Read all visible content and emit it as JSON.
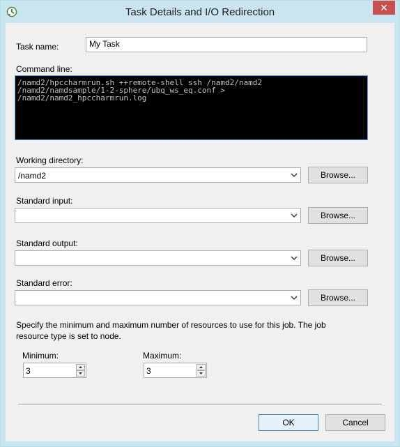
{
  "window": {
    "title": "Task Details and I/O Redirection",
    "close_label": "✕"
  },
  "task_name": {
    "label": "Task name:",
    "value": "My Task"
  },
  "command_line": {
    "label": "Command line:",
    "value": "/namd2/hpccharmrun.sh ++remote-shell ssh /namd2/namd2\n/namd2/namdsample/1-2-sphere/ubq_ws_eq.conf >\n/namd2/namd2_hpccharmrun.log"
  },
  "working_directory": {
    "label": "Working directory:",
    "value": "/namd2",
    "browse_label": "Browse..."
  },
  "standard_input": {
    "label": "Standard input:",
    "value": "",
    "browse_label": "Browse..."
  },
  "standard_output": {
    "label": "Standard output:",
    "value": "",
    "browse_label": "Browse..."
  },
  "standard_error": {
    "label": "Standard error:",
    "value": "",
    "browse_label": "Browse..."
  },
  "resources": {
    "description": "Specify the minimum and maximum number of resources to use for this job. The job resource type is set to node.",
    "minimum_label": "Minimum:",
    "minimum_value": "3",
    "maximum_label": "Maximum:",
    "maximum_value": "3"
  },
  "buttons": {
    "ok_label": "OK",
    "cancel_label": "Cancel"
  },
  "icons": {
    "app": "hpc-task-icon",
    "dropdown": "chevron-down-icon"
  }
}
